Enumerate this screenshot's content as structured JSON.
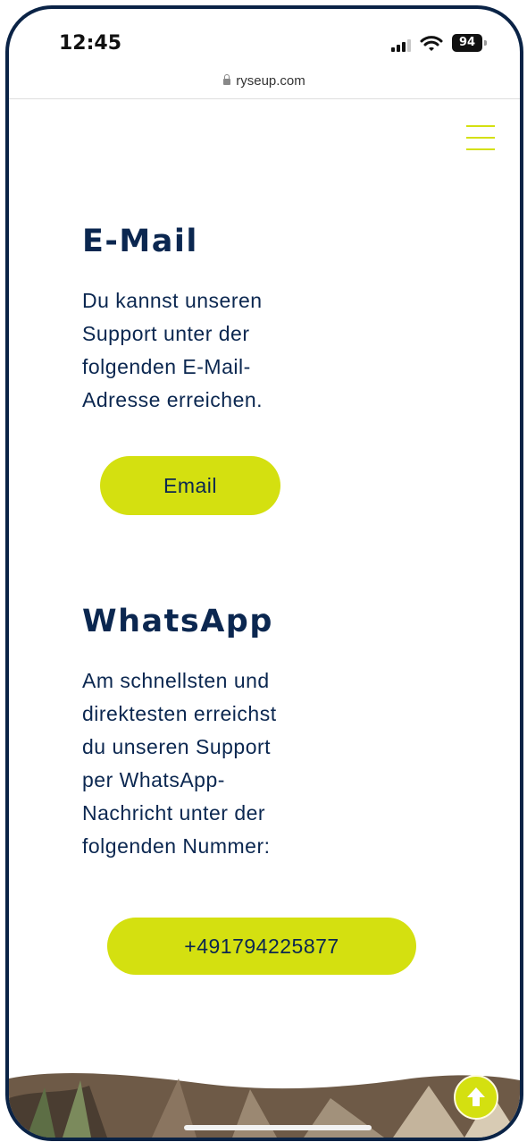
{
  "status_bar": {
    "time": "12:45",
    "battery": "94",
    "icons": [
      "signal-icon",
      "wifi-icon",
      "battery-icon"
    ]
  },
  "browser": {
    "url": "ryseup.com",
    "icons": [
      "lock-icon"
    ]
  },
  "header": {
    "menu_icon": "hamburger-menu-icon"
  },
  "email_section": {
    "title": "E-Mail",
    "description_lines": [
      "Du kannst unseren",
      "Support unter der",
      "folgenden E-Mail-",
      "Adresse erreichen."
    ],
    "button_label": "Email"
  },
  "whatsapp_section": {
    "title": "WhatsApp",
    "description_lines": [
      "Am schnellsten und",
      "direktesten erreichst",
      "du unseren Support",
      "per WhatsApp-",
      "Nachricht unter der",
      "folgenden Nummer:"
    ],
    "button_label": "+491794225877"
  },
  "scroll_top": {
    "icon": "arrow-up-icon"
  },
  "colors": {
    "accent": "#d4e010",
    "heading": "#0b2750",
    "frame": "#0a2346"
  }
}
